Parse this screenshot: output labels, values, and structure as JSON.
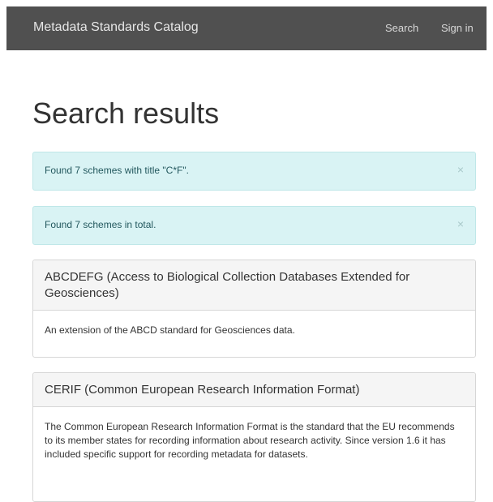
{
  "navbar": {
    "brand": "Metadata Standards Catalog",
    "links": [
      "Search",
      "Sign in"
    ]
  },
  "page": {
    "title": "Search results"
  },
  "alerts": [
    {
      "text": "Found 7 schemes with title \"C*F\".",
      "close": "×"
    },
    {
      "text": "Found 7 schemes in total.",
      "close": "×"
    }
  ],
  "results": [
    {
      "title": "ABCDEFG (Access to Biological Collection Databases Extended for Geosciences)",
      "description": "An extension of the ABCD standard for Geosciences data."
    },
    {
      "title": "CERIF (Common European Research Information Format)",
      "description": "The Common European Research Information Format is the standard that the EU recommends to its member states for recording information about research activity. Since version 1.6 it has included specific support for recording metadata for datasets."
    }
  ],
  "colors": {
    "navbar_bg": "#505050",
    "alert_bg": "#d9f3f4",
    "alert_text": "#23585e",
    "panel_heading_bg": "#f5f5f5"
  }
}
